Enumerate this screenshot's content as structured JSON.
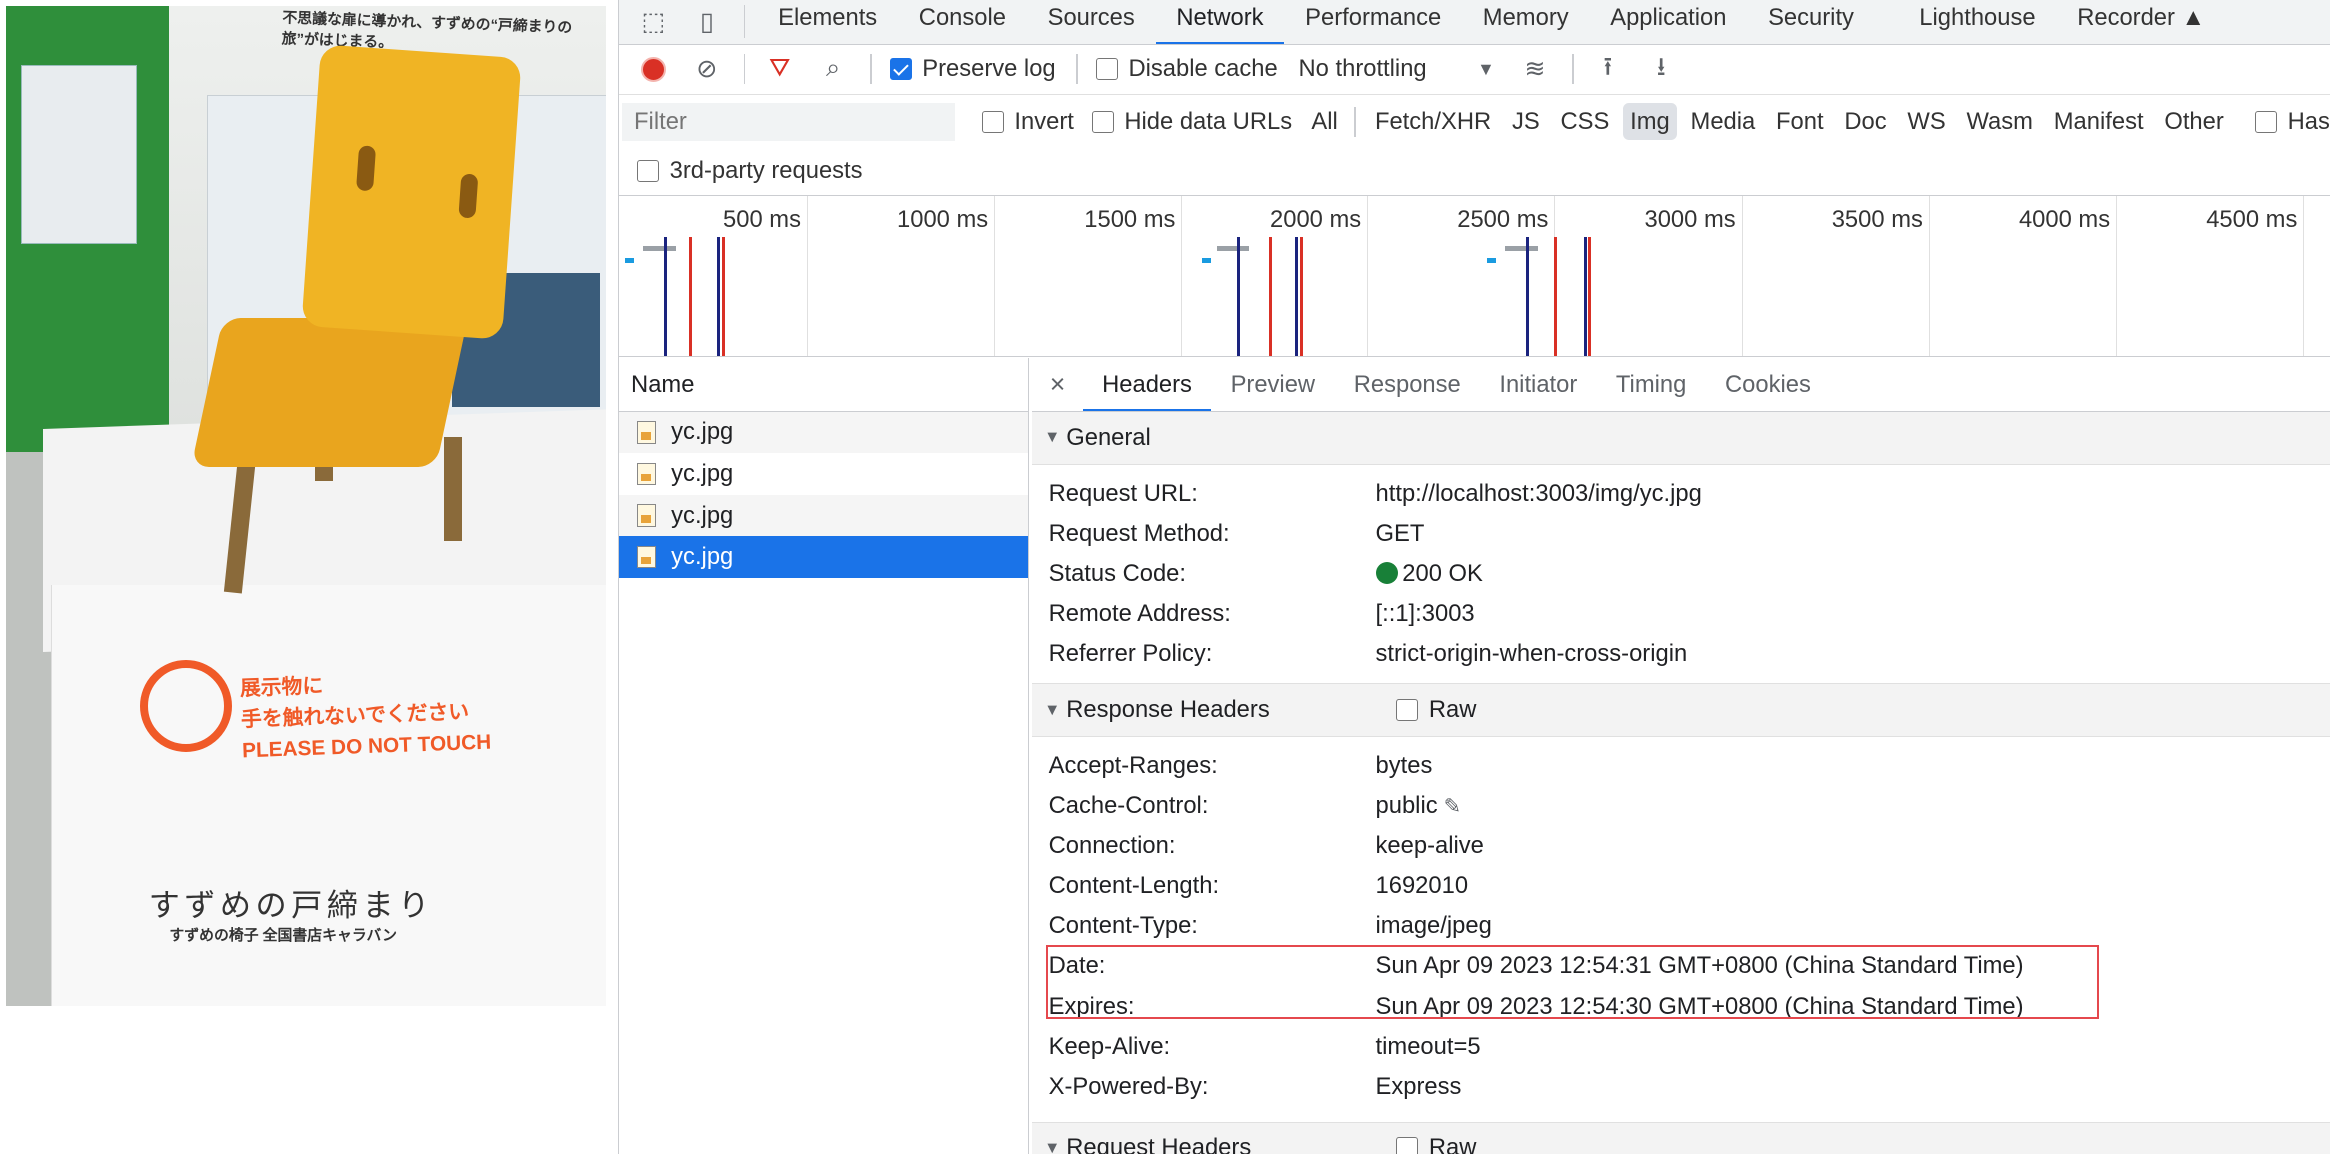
{
  "photo": {
    "top_text": "不思議な扉に導かれ、すずめの“戸締まりの旅”がはじまる。",
    "sign_line1": "展示物に",
    "sign_line2": "手を触れないでください",
    "sign_line3": "PLEASE DO NOT TOUCH",
    "title": "すずめの戸締まり",
    "subtitle": "すずめの椅子 全国書店キャラバン"
  },
  "devtools": {
    "tabs": [
      "Elements",
      "Console",
      "Sources",
      "Network",
      "Performance",
      "Memory",
      "Application",
      "Security",
      "Lighthouse",
      "Recorder"
    ],
    "active_tab": "Network",
    "toolbar": {
      "preserve_log": "Preserve log",
      "disable_cache": "Disable cache",
      "throttling": "No throttling"
    },
    "filter": {
      "placeholder": "Filter",
      "invert": "Invert",
      "hide_data_urls": "Hide data URLs",
      "types": [
        "All",
        "Fetch/XHR",
        "JS",
        "CSS",
        "Img",
        "Media",
        "Font",
        "Doc",
        "WS",
        "Wasm",
        "Manifest",
        "Other"
      ],
      "active_type": "Img",
      "has": "Has",
      "third_party": "3rd-party requests"
    },
    "timeline_ticks": [
      "500 ms",
      "1000 ms",
      "1500 ms",
      "2000 ms",
      "2500 ms",
      "3000 ms",
      "3500 ms",
      "4000 ms",
      "4500 ms"
    ],
    "name_header": "Name",
    "requests": [
      "yc.jpg",
      "yc.jpg",
      "yc.jpg",
      "yc.jpg"
    ],
    "selected_index": 3,
    "detail_tabs": [
      "Headers",
      "Preview",
      "Response",
      "Initiator",
      "Timing",
      "Cookies"
    ],
    "active_detail_tab": "Headers",
    "general": {
      "title": "General",
      "rows": [
        {
          "k": "Request URL:",
          "v": "http://localhost:3003/img/yc.jpg"
        },
        {
          "k": "Request Method:",
          "v": "GET"
        },
        {
          "k": "Status Code:",
          "v": "200 OK"
        },
        {
          "k": "Remote Address:",
          "v": "[::1]:3003"
        },
        {
          "k": "Referrer Policy:",
          "v": "strict-origin-when-cross-origin"
        }
      ]
    },
    "response_headers": {
      "title": "Response Headers",
      "raw": "Raw",
      "rows": [
        {
          "k": "Accept-Ranges:",
          "v": "bytes"
        },
        {
          "k": "Cache-Control:",
          "v": "public"
        },
        {
          "k": "Connection:",
          "v": "keep-alive"
        },
        {
          "k": "Content-Length:",
          "v": "1692010"
        },
        {
          "k": "Content-Type:",
          "v": "image/jpeg"
        },
        {
          "k": "Date:",
          "v": "Sun Apr 09 2023 12:54:31 GMT+0800 (China Standard Time)"
        },
        {
          "k": "Expires:",
          "v": "Sun Apr 09 2023 12:54:30 GMT+0800 (China Standard Time)"
        },
        {
          "k": "Keep-Alive:",
          "v": "timeout=5"
        },
        {
          "k": "X-Powered-By:",
          "v": "Express"
        }
      ]
    },
    "request_headers": {
      "title": "Request Headers",
      "raw": "Raw"
    },
    "colors": {
      "accent": "#1a73e8",
      "status_ok": "#188038",
      "highlight_box": "#e5484d",
      "record": "#d93025"
    }
  }
}
